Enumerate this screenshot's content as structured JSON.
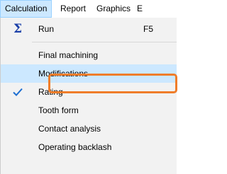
{
  "menubar": {
    "items": [
      "Calculation",
      "Report",
      "Graphics",
      "E"
    ]
  },
  "menu": {
    "run": {
      "label": "Run",
      "shortcut": "F5",
      "icon": "sigma-icon"
    },
    "final_machining": {
      "label": "Final machining"
    },
    "modifications": {
      "label": "Modifications",
      "highlighted": true
    },
    "rating": {
      "label": "Rating",
      "checked": true,
      "icon": "checkmark-icon"
    },
    "tooth_form": {
      "label": "Tooth form"
    },
    "contact_analysis": {
      "label": "Contact analysis"
    },
    "operating_backlash": {
      "label": "Operating backlash"
    }
  },
  "colors": {
    "highlight_annotation": "#ef7d2a",
    "selection": "#cce8ff",
    "menu_background": "#f2f2f2",
    "check": "#1e6fd1"
  }
}
